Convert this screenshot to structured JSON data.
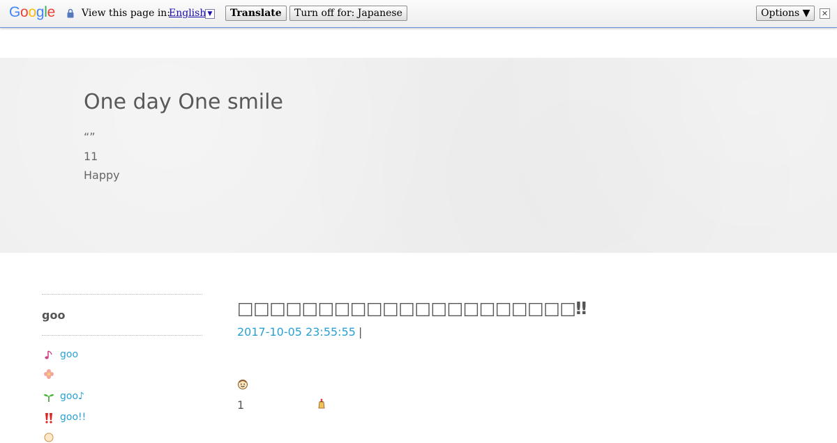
{
  "translate_bar": {
    "logo": [
      "G",
      "o",
      "o",
      "g",
      "l",
      "e"
    ],
    "prompt": "View this page in:",
    "language": "English",
    "translate_label": "Translate",
    "turn_off_label": "Turn off for: Japanese",
    "options_label": "Options ▼",
    "close_glyph": "✕"
  },
  "header": {
    "title": "One day One smile",
    "line1": "“”",
    "line2": "11",
    "line3": "Happy"
  },
  "sidebar": {
    "heading": "goo",
    "items": [
      {
        "label": "goo",
        "icon": "music-note-icon"
      },
      {
        "label": "",
        "icon": "flower-icon"
      },
      {
        "label": "goo♪",
        "icon": "sprout-icon"
      },
      {
        "label": "goo!!",
        "icon": "double-exclamation-icon"
      },
      {
        "label": "",
        "icon": "face-icon"
      }
    ]
  },
  "post": {
    "title": "□□□□□□□□□□□□□□□□□□□□□‼",
    "date": "2017-10-05 23:55:55",
    "separator": "|",
    "number": "1",
    "emojis": [
      "smiling-face-icon",
      "pudding-icon"
    ]
  },
  "colors": {
    "link": "#2aa0d4",
    "text": "#555555",
    "header_bg": "#efefef",
    "bar_border": "#6b90da"
  }
}
